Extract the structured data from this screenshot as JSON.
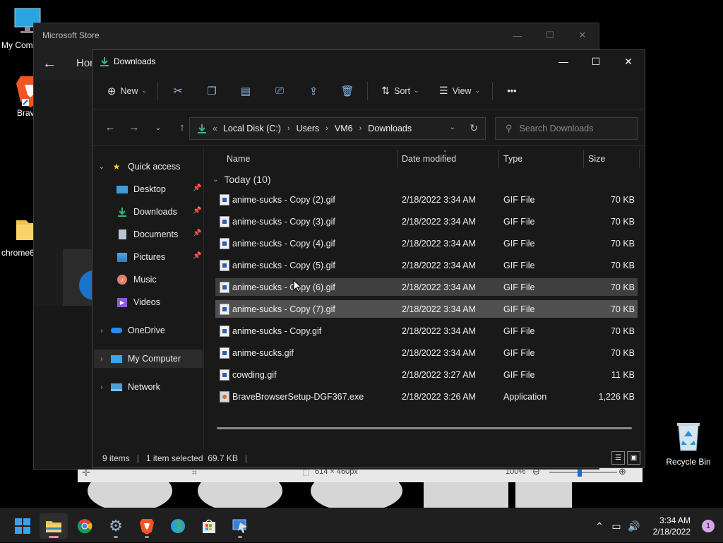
{
  "desktop": {
    "icons": [
      {
        "label": "My Com",
        "name": "my-computer"
      },
      {
        "label": "Brav",
        "name": "brave"
      },
      {
        "label": "chrome6",
        "name": "chrome-folder"
      },
      {
        "label": "Recycle Bin",
        "name": "recycle-bin"
      }
    ]
  },
  "background_app": {
    "dimensions": "614 × 460px",
    "zoom": "100%"
  },
  "store": {
    "title": "Microsoft Store",
    "home_label": "Hon"
  },
  "explorer": {
    "title": "Downloads",
    "toolbar": {
      "new_label": "New",
      "sort_label": "Sort",
      "view_label": "View",
      "more_label": "•••"
    },
    "address": {
      "prefix": "«",
      "crumbs": [
        "Local Disk (C:)",
        "Users",
        "VM6",
        "Downloads"
      ]
    },
    "search_placeholder": "Search Downloads",
    "sidebar": {
      "quick_access": "Quick access",
      "items": [
        {
          "label": "Desktop"
        },
        {
          "label": "Downloads"
        },
        {
          "label": "Documents"
        },
        {
          "label": "Pictures"
        },
        {
          "label": "Music"
        },
        {
          "label": "Videos"
        }
      ],
      "onedrive": "OneDrive",
      "my_computer": "My Computer",
      "network": "Network"
    },
    "columns": {
      "name": "Name",
      "date": "Date modified",
      "type": "Type",
      "size": "Size"
    },
    "group_label": "Today (10)",
    "files": [
      {
        "name": "anime-sucks - Copy (2).gif",
        "date": "2/18/2022 3:34 AM",
        "type": "GIF File",
        "size": "70 KB"
      },
      {
        "name": "anime-sucks - Copy (3).gif",
        "date": "2/18/2022 3:34 AM",
        "type": "GIF File",
        "size": "70 KB"
      },
      {
        "name": "anime-sucks - Copy (4).gif",
        "date": "2/18/2022 3:34 AM",
        "type": "GIF File",
        "size": "70 KB"
      },
      {
        "name": "anime-sucks - Copy (5).gif",
        "date": "2/18/2022 3:34 AM",
        "type": "GIF File",
        "size": "70 KB"
      },
      {
        "name": "anime-sucks - Copy (6).gif",
        "date": "2/18/2022 3:34 AM",
        "type": "GIF File",
        "size": "70 KB"
      },
      {
        "name": "anime-sucks - Copy (7).gif",
        "date": "2/18/2022 3:34 AM",
        "type": "GIF File",
        "size": "70 KB"
      },
      {
        "name": "anime-sucks - Copy.gif",
        "date": "2/18/2022 3:34 AM",
        "type": "GIF File",
        "size": "70 KB"
      },
      {
        "name": "anime-sucks.gif",
        "date": "2/18/2022 3:34 AM",
        "type": "GIF File",
        "size": "70 KB"
      },
      {
        "name": "cowding.gif",
        "date": "2/18/2022 3:27 AM",
        "type": "GIF File",
        "size": "11 KB"
      },
      {
        "name": "BraveBrowserSetup-DGF367.exe",
        "date": "2/18/2022 3:26 AM",
        "type": "Application",
        "size": "1,226 KB"
      }
    ],
    "status": {
      "count": "9 items",
      "selection": "1 item selected  69.7 KB"
    }
  },
  "taskbar": {
    "time": "3:34 AM",
    "date": "2/18/2022",
    "notifications": "1"
  }
}
